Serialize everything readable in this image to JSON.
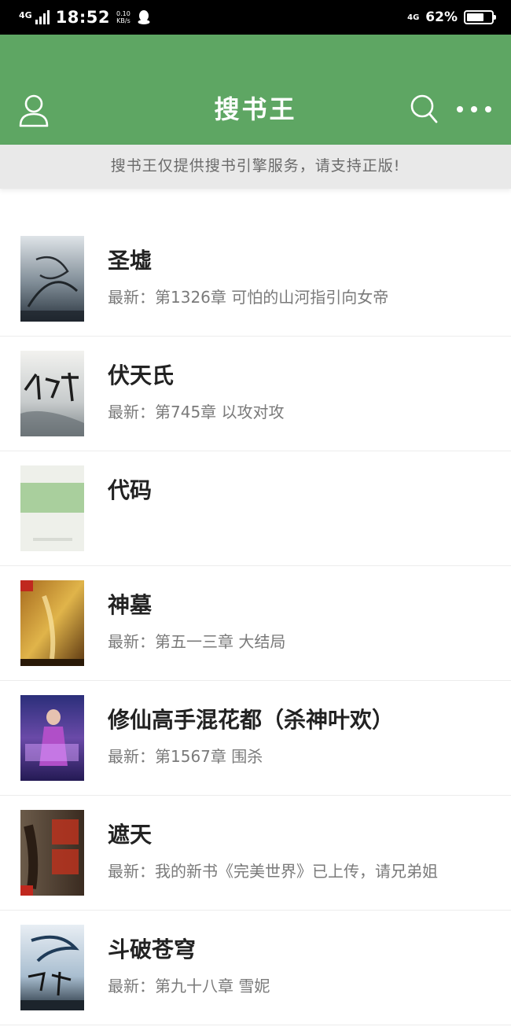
{
  "status_bar": {
    "signal_label": "4G",
    "time": "18:52",
    "speed_value": "0.10",
    "speed_unit": "KB/s",
    "network_label": "4G",
    "battery_percent": "62%",
    "battery_level": 0.62
  },
  "header": {
    "title": "搜书王",
    "icons": {
      "left": "user-icon",
      "search": "search-icon",
      "more": "more-icon"
    },
    "colors": {
      "background": "#5ea663",
      "text": "#ffffff"
    }
  },
  "notice": "搜书王仅提供搜书引擎服务，请支持正版!",
  "books": [
    {
      "title": "圣墟",
      "latest": "最新：第1326章 可怕的山河指引向女帝"
    },
    {
      "title": "伏天氏",
      "latest": "最新：第745章 以攻对攻"
    },
    {
      "title": "代码",
      "latest": ""
    },
    {
      "title": "神墓",
      "latest": "最新：第五一三章 大结局"
    },
    {
      "title": "修仙高手混花都（杀神叶欢）",
      "latest": "最新：第1567章 围杀"
    },
    {
      "title": "遮天",
      "latest": "最新：我的新书《完美世界》已上传，请兄弟姐"
    },
    {
      "title": "斗破苍穹",
      "latest": "最新：第九十八章 雪妮"
    }
  ]
}
